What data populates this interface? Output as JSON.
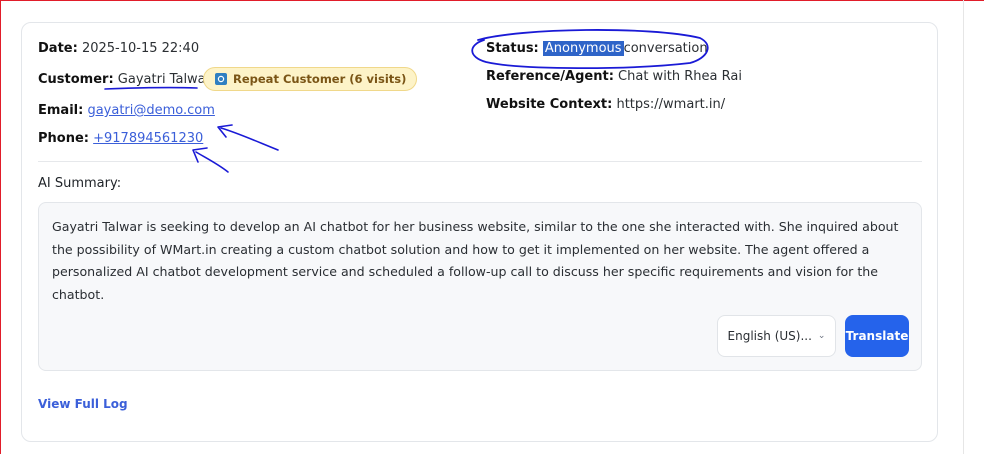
{
  "details": {
    "date_label": "Date:",
    "date_value": "2025-10-15 22:40",
    "customer_label": "Customer:",
    "customer_value": "Gayatri Talwar",
    "repeat_badge": "Repeat Customer (6 visits)",
    "email_label": "Email:",
    "email_value": "gayatri@demo.com",
    "phone_label": "Phone:",
    "phone_value": "+917894561230",
    "status_label": "Status:",
    "status_highlight": "Anonymous",
    "status_rest": "conversation",
    "reference_label": "Reference/Agent:",
    "reference_value": "Chat with Rhea Rai",
    "website_label": "Website Context:",
    "website_value": "https://wmart.in/"
  },
  "summary": {
    "title": "AI Summary:",
    "text": "Gayatri Talwar is seeking to develop an AI chatbot for her business website, similar to the one she interacted with. She inquired about the possibility of WMart.in creating a custom chatbot solution and how to get it implemented on her website. The agent offered a personalized AI chatbot development service and scheduled a follow-up call to discuss her specific requirements and vision for the chatbot.",
    "language_selected": "English (US)...",
    "translate_label": "Translate"
  },
  "footer": {
    "view_full_log": "View Full Log"
  },
  "colors": {
    "accent": "#2563eb",
    "link": "#3b5fd9",
    "badge_bg": "#fdf3c8",
    "annotation": "#1a1ad6"
  }
}
